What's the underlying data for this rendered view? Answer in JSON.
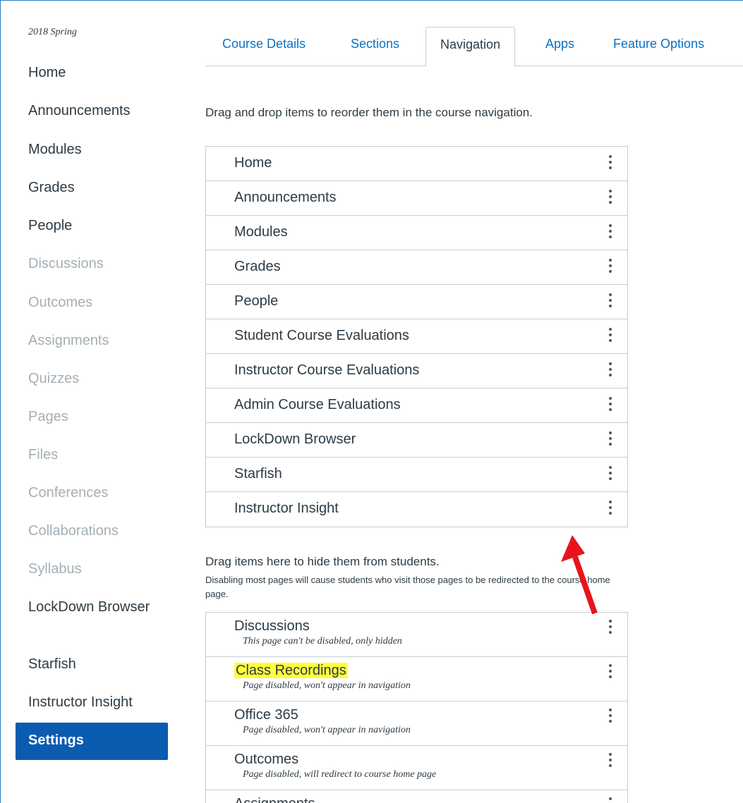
{
  "sidebar": {
    "term": "2018 Spring",
    "items": [
      {
        "label": "Home",
        "hidden": false
      },
      {
        "label": "Announcements",
        "hidden": false
      },
      {
        "label": "Modules",
        "hidden": false
      },
      {
        "label": "Grades",
        "hidden": false
      },
      {
        "label": "People",
        "hidden": false
      },
      {
        "label": "Discussions",
        "hidden": true
      },
      {
        "label": "Outcomes",
        "hidden": true
      },
      {
        "label": "Assignments",
        "hidden": true
      },
      {
        "label": "Quizzes",
        "hidden": true
      },
      {
        "label": "Pages",
        "hidden": true
      },
      {
        "label": "Files",
        "hidden": true
      },
      {
        "label": "Conferences",
        "hidden": true
      },
      {
        "label": "Collaborations",
        "hidden": true
      },
      {
        "label": "Syllabus",
        "hidden": true
      },
      {
        "label": "LockDown Browser",
        "hidden": false
      },
      {
        "label": "Starfish",
        "hidden": false
      },
      {
        "label": "Instructor Insight",
        "hidden": false
      },
      {
        "label": "Settings",
        "hidden": false,
        "active": true
      }
    ]
  },
  "tabs": [
    {
      "label": "Course Details"
    },
    {
      "label": "Sections"
    },
    {
      "label": "Navigation",
      "selected": true
    },
    {
      "label": "Apps"
    },
    {
      "label": "Feature Options"
    }
  ],
  "navigation": {
    "instruction": "Drag and drop items to reorder them in the course navigation.",
    "enabled_items": [
      "Home",
      "Announcements",
      "Modules",
      "Grades",
      "People",
      "Student Course Evaluations",
      "Instructor Course Evaluations",
      "Admin Course Evaluations",
      "LockDown Browser",
      "Starfish",
      "Instructor Insight"
    ],
    "hidden_title": "Drag items here to hide them from students.",
    "hidden_subtitle": "Disabling most pages will cause students who visit those pages to be redirected to the course home page.",
    "hidden_items": [
      {
        "label": "Discussions",
        "desc": "This page can't be disabled, only hidden",
        "highlight": false
      },
      {
        "label": "Class Recordings",
        "desc": "Page disabled, won't appear in navigation",
        "highlight": true
      },
      {
        "label": "Office 365",
        "desc": "Page disabled, won't appear in navigation",
        "highlight": false
      },
      {
        "label": "Outcomes",
        "desc": "Page disabled, will redirect to course home page",
        "highlight": false
      },
      {
        "label": "Assignments",
        "desc": "",
        "highlight": false
      }
    ]
  },
  "colors": {
    "link": "#0b72c4",
    "active_bg": "#0b5bb0",
    "hidden_text": "#a5afb5",
    "highlight": "#ffff3b",
    "annotation_arrow": "#e8141b"
  },
  "icons": {
    "row_menu": "kebab-vertical-icon"
  }
}
